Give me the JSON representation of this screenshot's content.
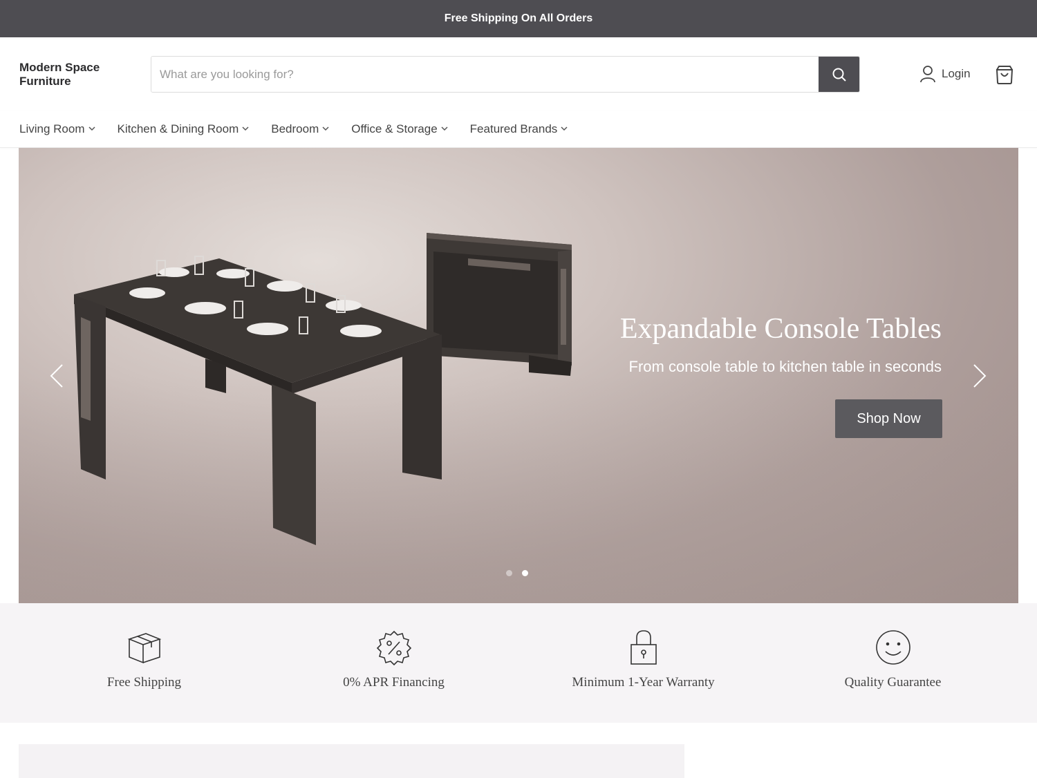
{
  "announcement": "Free Shipping On All Orders",
  "brand": "Modern Space Furniture",
  "search": {
    "placeholder": "What are you looking for?"
  },
  "account": {
    "login_label": "Login"
  },
  "nav": [
    "Living Room",
    "Kitchen & Dining Room",
    "Bedroom",
    "Office & Storage",
    "Featured Brands"
  ],
  "hero": {
    "title": "Expandable Console Tables",
    "subtitle": "From console table to kitchen table in seconds",
    "cta_label": "Shop Now",
    "slide_count": 2,
    "active_slide": 2
  },
  "features": [
    {
      "icon": "box-icon",
      "label": "Free Shipping"
    },
    {
      "icon": "percent-badge-icon",
      "label": "0% APR Financing"
    },
    {
      "icon": "lock-icon",
      "label": "Minimum 1-Year Warranty"
    },
    {
      "icon": "smiley-icon",
      "label": "Quality Guarantee"
    }
  ],
  "colors": {
    "announcement_bg": "#4e4d52",
    "button_bg": "#5b5a5e",
    "features_bg": "#f6f4f6"
  }
}
